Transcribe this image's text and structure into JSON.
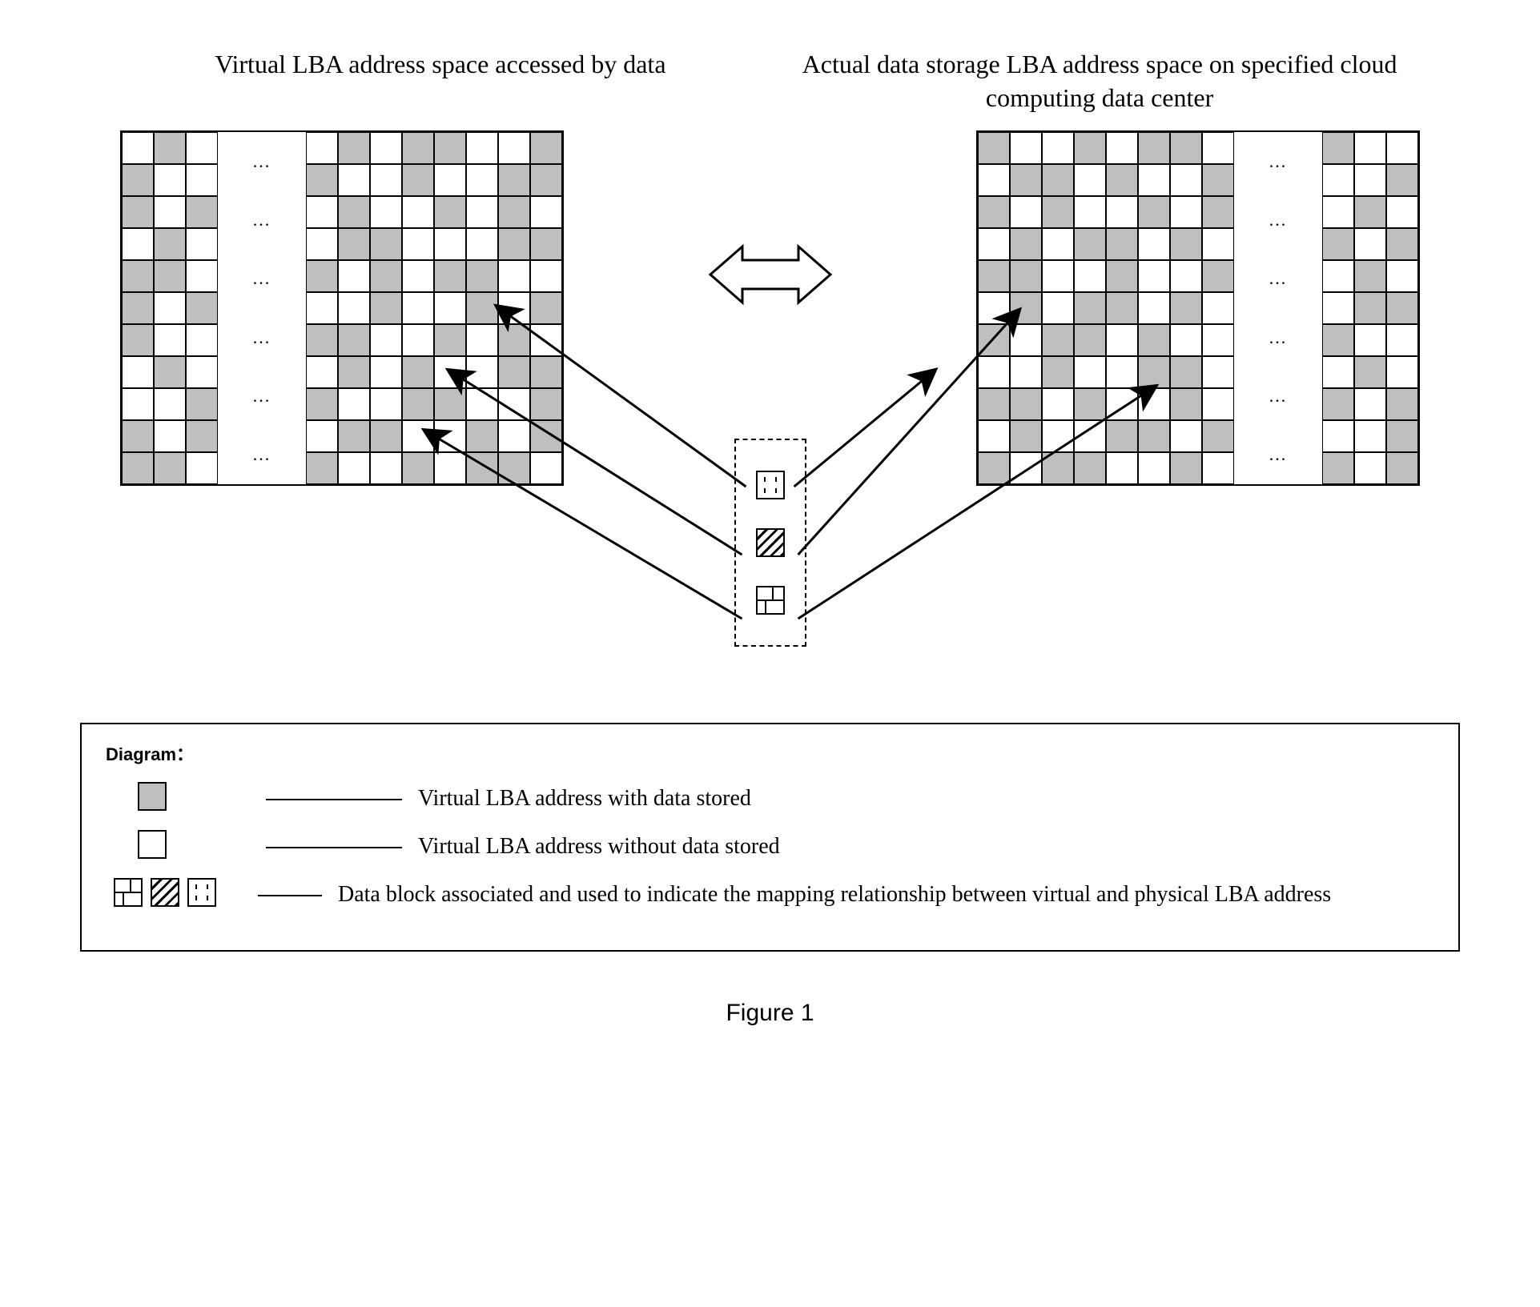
{
  "titles": {
    "left": "Virtual LBA address space accessed by data",
    "right": "Actual data storage LBA address space on specified cloud computing data center"
  },
  "ellipsis": "...",
  "legend": {
    "heading": "Diagram：",
    "item1": "Virtual LBA address with data stored",
    "item2": "Virtual LBA address without data stored",
    "item3": "Data block associated and used to indicate the mapping relationship between virtual and physical LBA address"
  },
  "figure_caption": "Figure 1",
  "grid_patterns": {
    "description": "Two address-space blocks, each 11 rows tall. Each block = 3-col segment + ellipsis column + 8-col segment. 'g' = gray (data stored), 'w' = white (empty).",
    "left_narrow_rows": [
      "wgw",
      "gww",
      "gwg",
      "wgw",
      "ggw",
      "gwg",
      "gww",
      "wgw",
      "wwg",
      "gwg",
      "ggw"
    ],
    "left_wide_rows": [
      "wgwggwwg",
      "gwwgwwgg",
      "wgwwgwgw",
      "wggwwwgg",
      "gwgwggww",
      "wwgwwgwg",
      "ggwwgwgw",
      "wgwgwwgg",
      "gwwggwwg",
      "wggwwgwg",
      "gwwgwggw"
    ],
    "right_wide_rows": [
      "gwwgwggw",
      "wggwgwwg",
      "gwgwwgwg",
      "wgwggwgw",
      "ggwwgwwg",
      "wgwggwgw",
      "gwggwgww",
      "wwgwwggw",
      "ggwgwwgw",
      "wgwwggwg",
      "gwggwwgw"
    ],
    "right_narrow_rows": [
      "gww",
      "wwg",
      "wgw",
      "gwg",
      "wgw",
      "wgg",
      "gww",
      "wgw",
      "gwg",
      "wwg",
      "gwg"
    ]
  },
  "mapping_blocks": [
    "dot-pattern",
    "diagonal-hatch",
    "brick-pattern"
  ]
}
